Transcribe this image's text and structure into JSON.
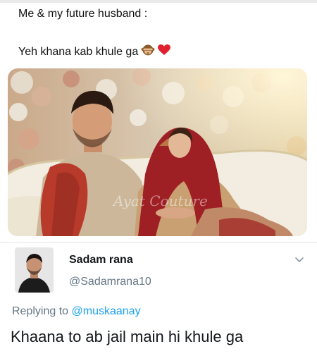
{
  "post": {
    "line1": "Me & my future husband :",
    "line2": "Yeh khana kab khule ga",
    "line2_emojis": [
      "see-no-evil-monkey",
      "red-heart"
    ]
  },
  "photo": {
    "description_icon": "wedding-couple-photo",
    "watermark": "Ayat Couture"
  },
  "tweet": {
    "display_name": "Sadam rana",
    "handle": "@Sadamrana10",
    "replying_prefix": "Replying to",
    "replying_handle": "@muskaanay",
    "text": "Khaana to ab jail main hi khule ga"
  },
  "colors": {
    "link": "#1da1f2",
    "secondary_text": "#657786",
    "primary_text": "#14171a"
  }
}
